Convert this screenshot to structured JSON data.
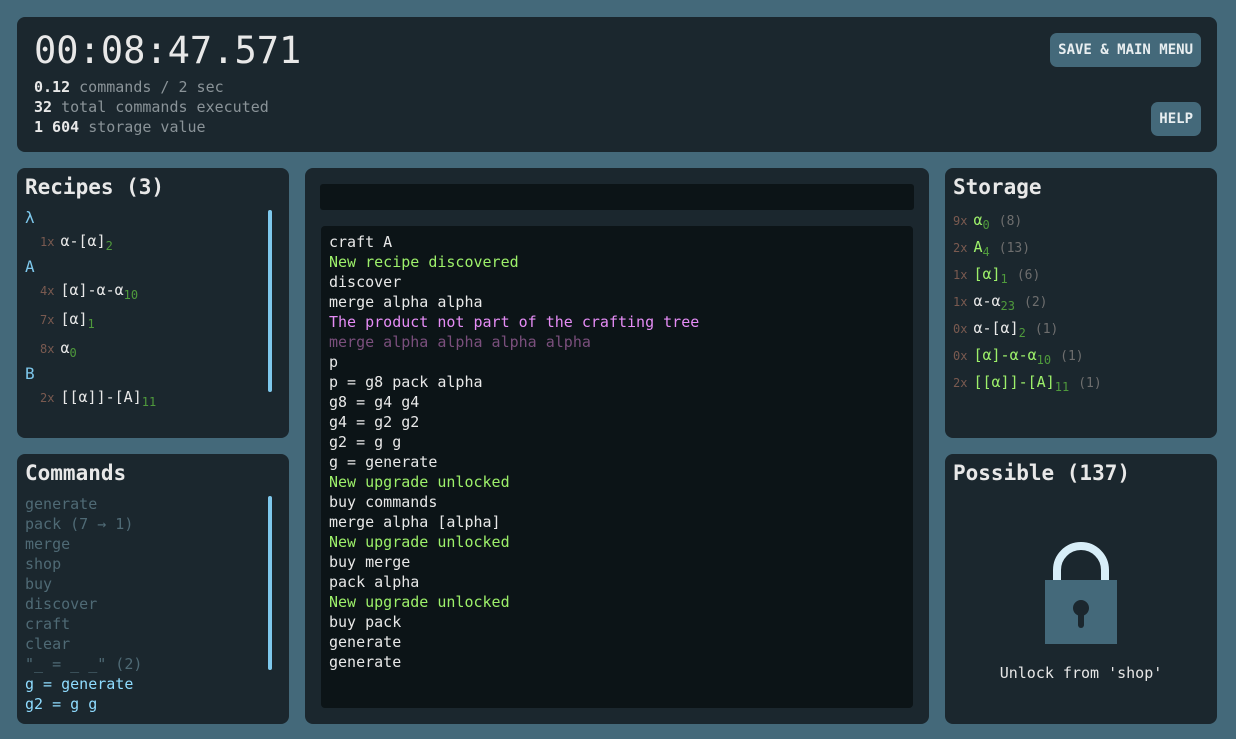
{
  "header": {
    "timer": "00:08:47.571",
    "stats": [
      {
        "value": "0.12",
        "label": "commands / 2 sec"
      },
      {
        "value": "32",
        "label": "total commands executed"
      },
      {
        "value": "1 604",
        "label": "storage value"
      }
    ],
    "save_button": "SAVE & MAIN MENU",
    "help_button": "HELP"
  },
  "recipes": {
    "title": "Recipes (3)",
    "groups": [
      {
        "name": "λ",
        "items": [
          {
            "count": "1x",
            "name": "α-[α]",
            "sub": "2"
          }
        ]
      },
      {
        "name": "A",
        "items": [
          {
            "count": "4x",
            "name": "[α]-α-α",
            "sub": "10"
          },
          {
            "count": "7x",
            "name": "[α]",
            "sub": "1"
          },
          {
            "count": "8x",
            "name": "α",
            "sub": "0"
          }
        ]
      },
      {
        "name": "B",
        "items": [
          {
            "count": "2x",
            "name": "[[α]]-[A]",
            "sub": "11"
          }
        ]
      }
    ]
  },
  "commands": {
    "title": "Commands",
    "items": [
      "generate",
      "pack (7 → 1)",
      "merge",
      "shop",
      "buy",
      "discover",
      "craft",
      "clear",
      "\"_ = _ _\" (2)"
    ],
    "macros": [
      "g = generate",
      "g2 = g g"
    ]
  },
  "console": {
    "input_value": "",
    "log": [
      {
        "t": "craft A",
        "c": "w"
      },
      {
        "t": "New recipe discovered",
        "c": "g"
      },
      {
        "t": "discover",
        "c": "w"
      },
      {
        "t": "merge alpha alpha",
        "c": "w"
      },
      {
        "t": "The product not part of the crafting tree",
        "c": "m"
      },
      {
        "t": "merge alpha alpha alpha alpha",
        "c": "d"
      },
      {
        "t": "p",
        "c": "w"
      },
      {
        "t": "p = g8 pack alpha",
        "c": "w"
      },
      {
        "t": "g8 = g4 g4",
        "c": "w"
      },
      {
        "t": "g4 = g2 g2",
        "c": "w"
      },
      {
        "t": "g2 = g g",
        "c": "w"
      },
      {
        "t": "g = generate",
        "c": "w"
      },
      {
        "t": "New upgrade unlocked",
        "c": "g"
      },
      {
        "t": "buy commands",
        "c": "w"
      },
      {
        "t": "merge alpha [alpha]",
        "c": "w"
      },
      {
        "t": "New upgrade unlocked",
        "c": "g"
      },
      {
        "t": "buy merge",
        "c": "w"
      },
      {
        "t": "pack alpha",
        "c": "w"
      },
      {
        "t": "New upgrade unlocked",
        "c": "g"
      },
      {
        "t": "buy pack",
        "c": "w"
      },
      {
        "t": "generate",
        "c": "w"
      },
      {
        "t": "generate",
        "c": "w"
      }
    ]
  },
  "storage": {
    "title": "Storage",
    "items": [
      {
        "count": "9x",
        "name": "α",
        "sub": "0",
        "value": "(8)",
        "c": "g"
      },
      {
        "count": "2x",
        "name": "A",
        "sub": "4",
        "value": "(13)",
        "c": "g"
      },
      {
        "count": "1x",
        "name": "[α]",
        "sub": "1",
        "value": "(6)",
        "c": "g"
      },
      {
        "count": "1x",
        "name": "α-α",
        "sub": "23",
        "value": "(2)",
        "c": "w"
      },
      {
        "count": "0x",
        "name": "α-[α]",
        "sub": "2",
        "value": "(1)",
        "c": "w"
      },
      {
        "count": "0x",
        "name": "[α]-α-α",
        "sub": "10",
        "value": "(1)",
        "c": "g"
      },
      {
        "count": "2x",
        "name": "[[α]]-[A]",
        "sub": "11",
        "value": "(1)",
        "c": "g"
      }
    ]
  },
  "possible": {
    "title": "Possible (137)",
    "locked_text": "Unlock from 'shop'",
    "icon": "lock-icon"
  }
}
